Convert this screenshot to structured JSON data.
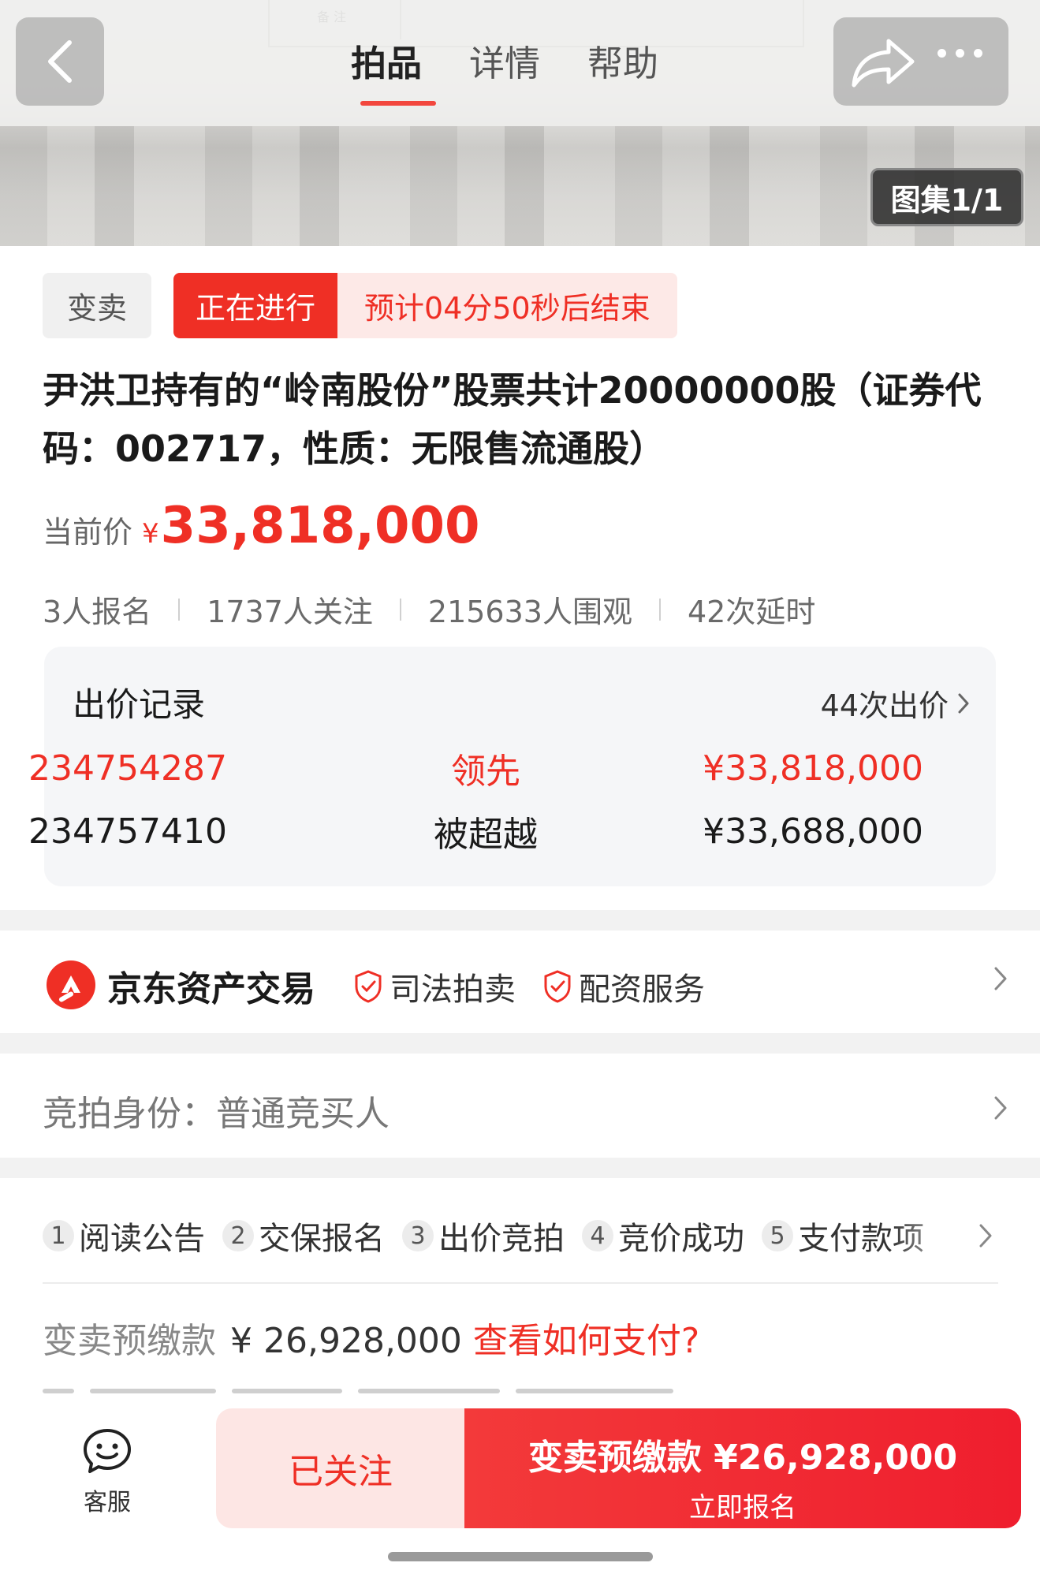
{
  "topbar": {
    "tabs": [
      "拍品",
      "详情",
      "帮助"
    ],
    "gallery_badge": "图集1/1",
    "hero_note": "备 注"
  },
  "tags": {
    "sell": "变卖",
    "status": "正在进行",
    "timer": "预计04分50秒后结束"
  },
  "item": {
    "title": "尹洪卫持有的“岭南股份”股票共计20000000股（证券代码：002717，性质：无限售流通股）"
  },
  "price": {
    "label": "当前价",
    "symbol": "¥",
    "value": "33,818,000"
  },
  "stats": [
    "3人报名",
    "1737人关注",
    "215633人围观",
    "42次延时"
  ],
  "bids": {
    "title": "出价记录",
    "count": "44次出价",
    "rows": [
      {
        "bidder": "234754287",
        "status": "领先",
        "amount": "¥33,818,000"
      },
      {
        "bidder": "234757410",
        "status": "被超越",
        "amount": "¥33,688,000"
      }
    ]
  },
  "platform": {
    "name": "京东资产交易",
    "badges": [
      "司法拍卖",
      "配资服务"
    ]
  },
  "identity": {
    "label": "竞拍身份：普通竞买人"
  },
  "steps": [
    {
      "num": "1",
      "label": "阅读公告"
    },
    {
      "num": "2",
      "label": "交保报名"
    },
    {
      "num": "3",
      "label": "出价竞拍"
    },
    {
      "num": "4",
      "label": "竞价成功"
    },
    {
      "num": "5",
      "label": "支付款项"
    }
  ],
  "deposit": {
    "label": "变卖预缴款",
    "amount": "¥ 26,928,000",
    "link": "查看如何支付?"
  },
  "bottom": {
    "service": "客服",
    "follow": "已关注",
    "apply_line1": "变卖预缴款 ¥26,928,000",
    "apply_line2": "立即报名"
  },
  "colors": {
    "accent": "#ef2f25",
    "card_bg": "#f5f6f8"
  }
}
